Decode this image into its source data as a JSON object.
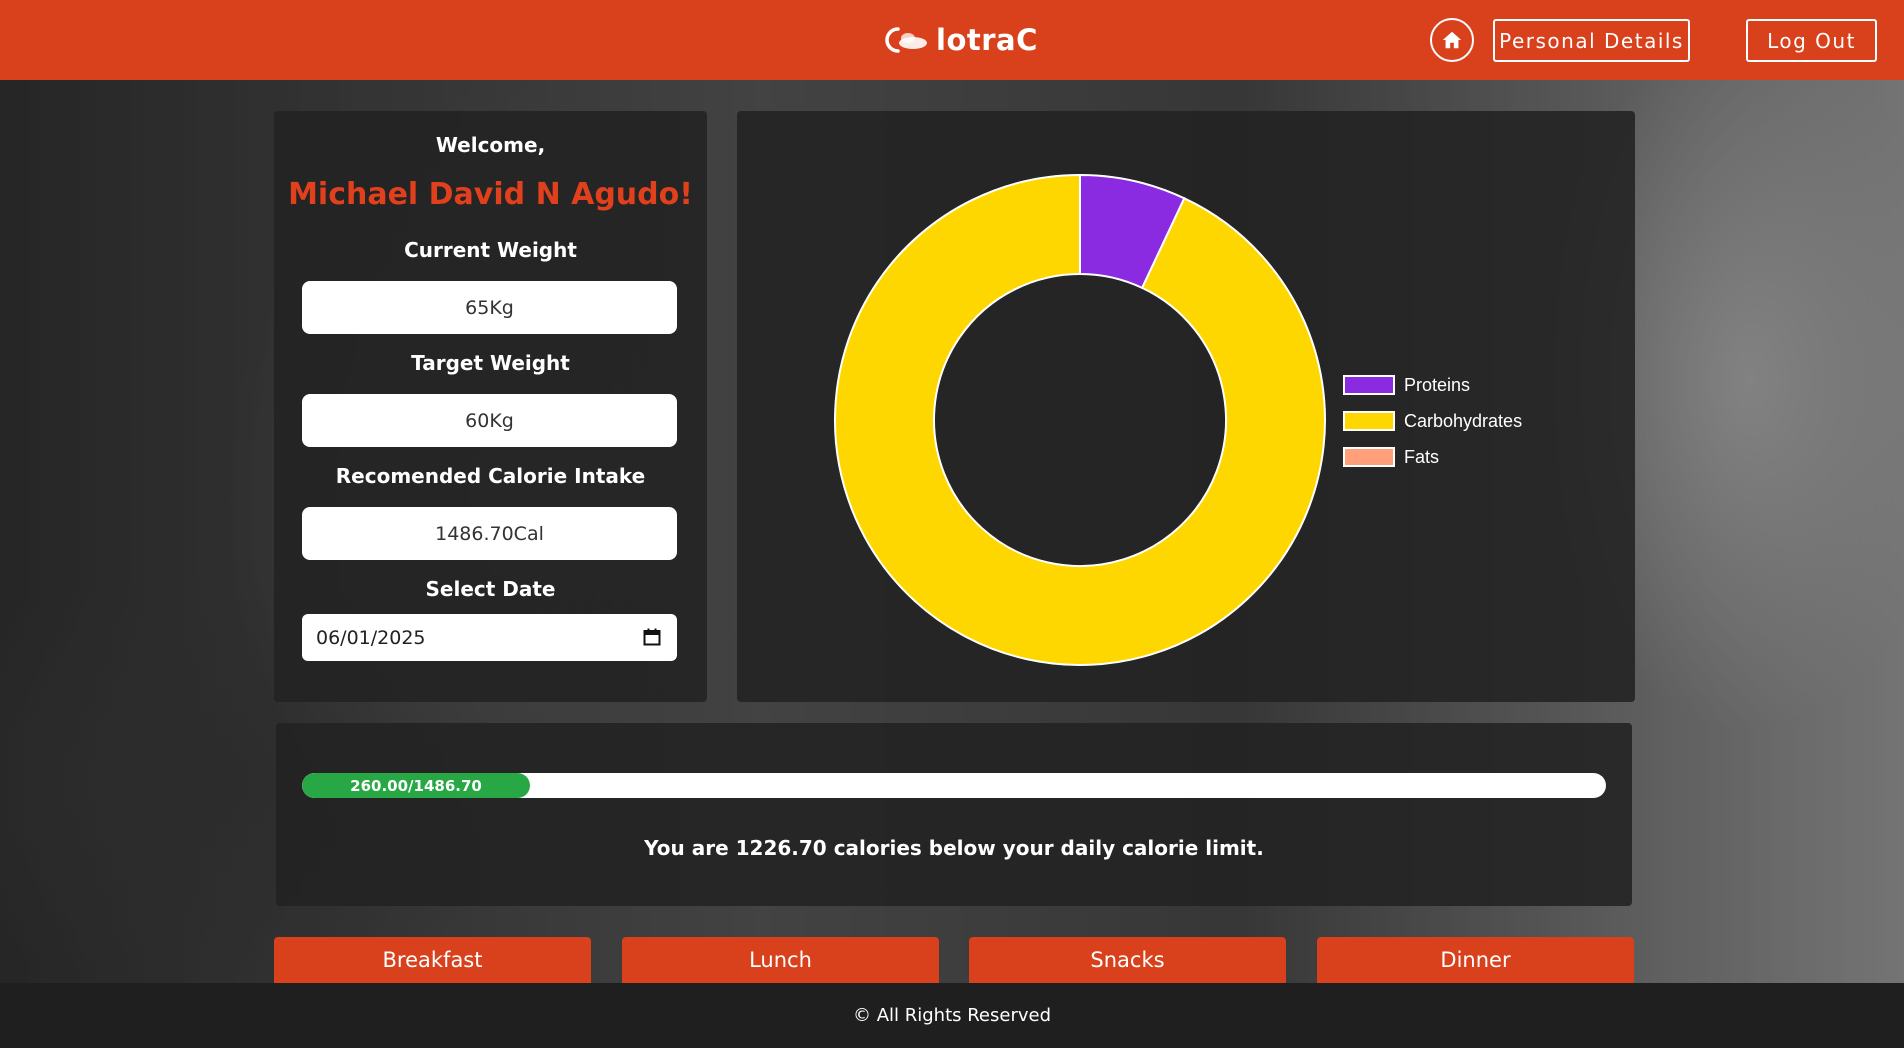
{
  "header": {
    "brand": "lotraC",
    "home_icon": "home-icon",
    "personal_details_label": "Personal Details",
    "logout_label": "Log Out",
    "accent_color": "#d9401c"
  },
  "profile": {
    "welcome": "Welcome,",
    "name": "Michael David N Agudo!",
    "current_weight_label": "Current Weight",
    "current_weight_value": "65Kg",
    "target_weight_label": "Target Weight",
    "target_weight_value": "60Kg",
    "calorie_label": "Recomended Calorie Intake",
    "calorie_value": "1486.70Cal",
    "date_label": "Select Date",
    "date_value": "06/01/2025"
  },
  "chart_data": {
    "type": "pie",
    "style": "doughnut",
    "legend_position": "right",
    "series": [
      {
        "name": "Proteins",
        "value": 7,
        "color": "#8a2be2"
      },
      {
        "name": "Carbohydrates",
        "value": 93,
        "color": "#ffd700"
      },
      {
        "name": "Fats",
        "value": 0,
        "color": "#ffa07a"
      }
    ]
  },
  "progress": {
    "consumed": 260.0,
    "limit": 1486.7,
    "label": "260.00/1486.70",
    "message": "You are 1226.70 calories below your daily calorie limit.",
    "fill_color": "#28a745"
  },
  "meals": {
    "breakfast": "Breakfast",
    "lunch": "Lunch",
    "snacks": "Snacks",
    "dinner": "Dinner"
  },
  "footer": {
    "text": "© All Rights Reserved"
  }
}
